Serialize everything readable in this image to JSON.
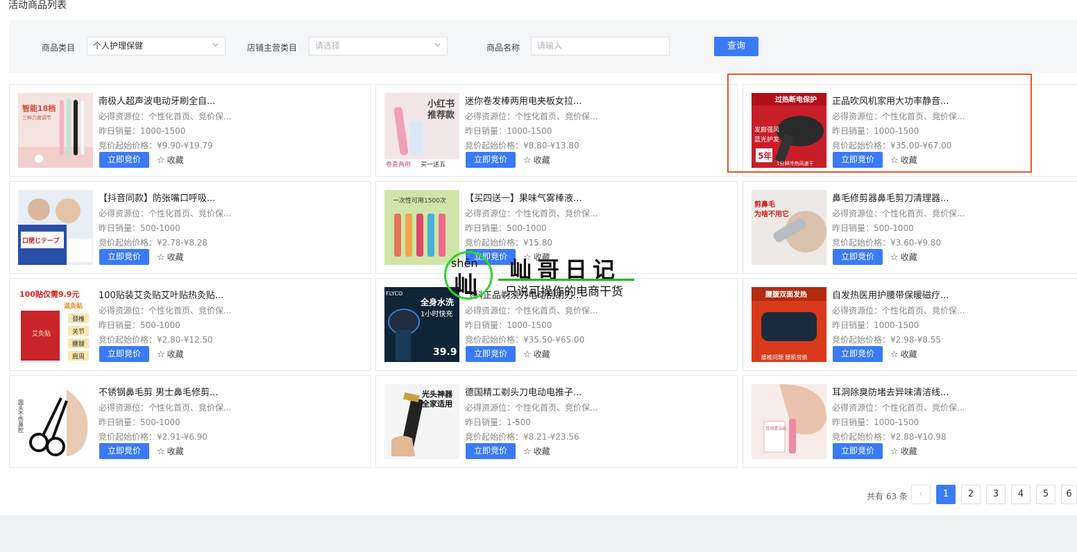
{
  "page": {
    "title": "活动商品列表"
  },
  "filters": {
    "category_label": "商品类目",
    "category_value": "个人护理保健",
    "shop_category_label": "店铺主营类目",
    "shop_category_placeholder": "请选择",
    "product_name_label": "商品名称",
    "product_name_placeholder": "请输入",
    "query_button": "查询"
  },
  "card_labels": {
    "bid_button": "立即竞价",
    "favorite": "收藏",
    "star_icon": "☆"
  },
  "products": [
    {
      "name": "南极人超声波电动牙刷全自...",
      "resource": "必得资源位：个性化首页、竞价保...",
      "sales": "昨日销量：1000-1500",
      "price": "竞价起始价格：¥9.90-¥19.79"
    },
    {
      "name": "迷你卷发棒两用电夹板女拉...",
      "resource": "必得资源位：个性化首页、竞价保...",
      "sales": "昨日销量：1000-1500",
      "price": "竞价起始价格：¥8.80-¥13.80"
    },
    {
      "name": "正品吹风机家用大功率静音...",
      "resource": "必得资源位：个性化首页、竞价保...",
      "sales": "昨日销量：1000-1500",
      "price": "竞价起始价格：¥35.00-¥67.00"
    },
    {
      "name": "【抖音同款】防张嘴口呼吸...",
      "resource": "必得资源位：个性化首页、竞价保...",
      "sales": "昨日销量：500-1000",
      "price": "竞价起始价格：¥2.78-¥8.28"
    },
    {
      "name": "【买四送一】果味气雾棒液...",
      "resource": "必得资源位：个性化首页、竞价保...",
      "sales": "昨日销量：500-1000",
      "price": "竞价起始价格：¥15.80"
    },
    {
      "name": "鼻毛修剪器鼻毛剪刀清理器...",
      "resource": "必得资源位：个性化首页、竞价保...",
      "sales": "昨日销量：500-1000",
      "price": "竞价起始价格：¥3.60-¥9.80"
    },
    {
      "name": "100贴装艾灸贴艾叶贴热灸贴...",
      "resource": "必得资源位：个性化首页、竞价保...",
      "sales": "昨日销量：500-1000",
      "price": "竞价起始价格：¥2.80-¥12.50"
    },
    {
      "name": "飞科正品剃须刀电动刮胡刀...",
      "resource": "必得资源位：个性化首页、竞价保...",
      "sales": "昨日销量：1000-1500",
      "price": "竞价起始价格：¥35.50-¥65.00"
    },
    {
      "name": "自发热医用护腰带保暖磁疗...",
      "resource": "必得资源位：个性化首页、竞价保...",
      "sales": "昨日销量：1000-1500",
      "price": "竞价起始价格：¥2.98-¥8.55"
    },
    {
      "name": "不锈钢鼻毛剪 男士鼻毛修剪...",
      "resource": "必得资源位：个性化首页、竞价保...",
      "sales": "昨日销量：500-1000",
      "price": "竞价起始价格：¥2.91-¥6.90"
    },
    {
      "name": "德国精工剃头刀电动电推子...",
      "resource": "必得资源位：个性化首页、竞价保...",
      "sales": "昨日销量：1-500",
      "price": "竞价起始价格：¥8.21-¥23.56"
    },
    {
      "name": "耳洞除臭防堵去异味清洁线...",
      "resource": "必得资源位：个性化首页、竞价保...",
      "sales": "昨日销量：1000-1500",
      "price": "竞价起始价格：¥2.88-¥10.98"
    }
  ],
  "thumb_text": {
    "t0": "智能18档",
    "t0b": "三种力度调节",
    "t1": "小红书",
    "t1b": "推荐款",
    "t1c": "卷直两用",
    "t1d": "买一送五",
    "t2": "过热断电保护",
    "t2b": "发廊强风",
    "t2c": "蓝光护发",
    "t2d": "5年",
    "t2e": "1分钟冷热风速干",
    "t3": "口閉じテープ",
    "t4": "一次性可用1500次",
    "t5": "剪鼻毛",
    "t5b": "为啥不用它",
    "t6": "100贴仅需9.9元",
    "t6b": "温灸贴",
    "t6c": "颈椎",
    "t6d": "关节",
    "t6e": "腰腿",
    "t6f": "肩周",
    "t6g": "艾灸贴",
    "t7": "全身水洗",
    "t7b": "1小时快充",
    "t7c": "39.9",
    "t7d": "FLYCO",
    "t8": "腰腹双面发热",
    "t8b": "腰椎问题 腰肌劳损",
    "t9": "圆头不伤鼻腔",
    "t10": "光头神器",
    "t10b": "全家适用",
    "t11": "耳洞清洁线"
  },
  "watermark": {
    "pinyin": "shēn",
    "char": "屾",
    "title": "屾哥日记",
    "subtitle": "只说可操作的电商干货"
  },
  "pagination": {
    "total": "共有 63 条",
    "prev_icon": "‹",
    "pages": [
      "1",
      "2",
      "3",
      "4",
      "5",
      "6"
    ],
    "current": "1"
  },
  "colors": {
    "primary": "#3a7bf5",
    "highlight": "#e8562a",
    "watermark_green": "#2ad62a"
  }
}
